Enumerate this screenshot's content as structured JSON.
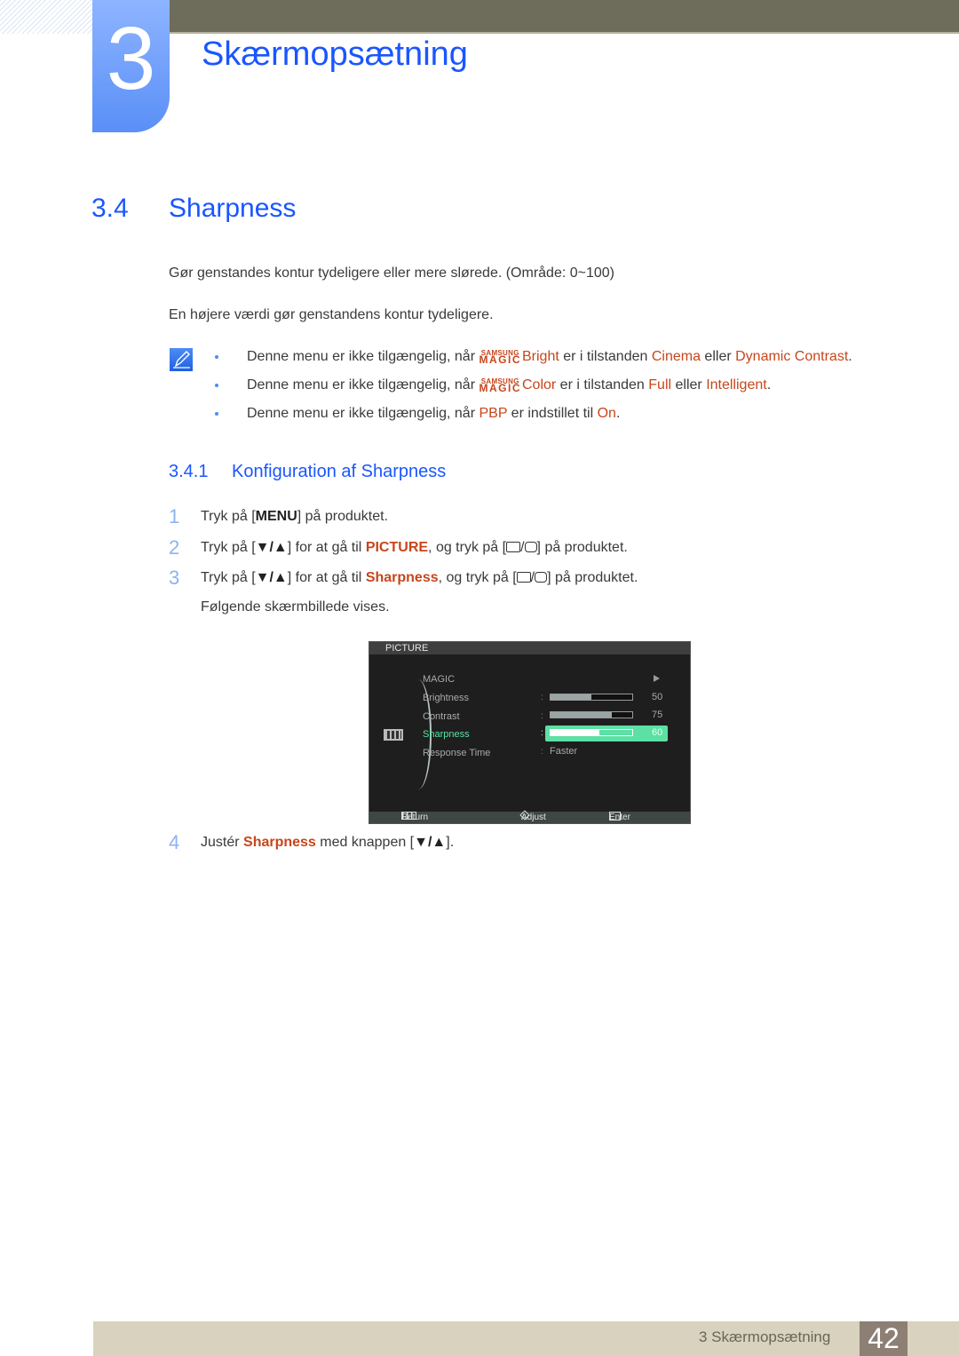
{
  "header": {
    "chapter_number": "3",
    "chapter_title": "Skærmopsætning"
  },
  "section": {
    "number": "3.4",
    "title": "Sharpness",
    "paragraphs": [
      "Gør genstandes kontur tydeligere eller mere slørede. (Område: 0~100)",
      "En højere værdi gør genstandens kontur tydeligere."
    ]
  },
  "notes": {
    "icon": "note-pencil-icon",
    "magic_top": "SAMSUNG",
    "magic_bottom": "MAGIC",
    "items": [
      {
        "pre": "Denne menu er ikke tilgængelig, når ",
        "magic_word": "Bright",
        "mid": " er i tilstanden ",
        "h1": "Cinema",
        "conj": " eller ",
        "h2": "Dynamic Contrast",
        "end": "."
      },
      {
        "pre": "Denne menu er ikke tilgængelig, når ",
        "magic_word": "Color",
        "mid": " er i tilstanden ",
        "h1": "Full",
        "conj": " eller ",
        "h2": "Intelligent",
        "end": "."
      },
      {
        "pre": "Denne menu er ikke tilgængelig, når ",
        "h0": "PBP",
        "mid": " er indstillet til ",
        "h1": "On",
        "end": "."
      }
    ]
  },
  "subsection": {
    "number": "3.4.1",
    "title": "Konfiguration af Sharpness"
  },
  "steps": [
    {
      "n": "1",
      "a": "Tryk på [",
      "key": "MENU",
      "b": "] på produktet."
    },
    {
      "n": "2",
      "a": "Tryk på [",
      "key": "▼/▲",
      "b": "] for at gå til ",
      "hl": "PICTURE",
      "c": ", og tryk på [",
      "d": "] på produktet."
    },
    {
      "n": "3",
      "a": "Tryk på [",
      "key": "▼/▲",
      "b": "] for at gå til ",
      "hl": "Sharpness",
      "c": ", og tryk på [",
      "d": "] på produktet.",
      "follow": "Følgende skærmbillede vises."
    },
    {
      "n": "4",
      "a": "Justér ",
      "hl": "Sharpness",
      "b": " med knappen [",
      "key": "▼/▲",
      "c": "]."
    }
  ],
  "osd": {
    "title": "PICTURE",
    "items": [
      {
        "label": "MAGIC",
        "type": "submenu"
      },
      {
        "label": "Brightness",
        "value": "50",
        "fraction": 0.5
      },
      {
        "label": "Contrast",
        "value": "75",
        "fraction": 0.75
      },
      {
        "label": "Sharpness",
        "value": "60",
        "fraction": 0.6,
        "active": true
      },
      {
        "label": "Response Time",
        "value": "Faster"
      }
    ],
    "colon": ":",
    "footer": {
      "return": "Return",
      "adjust": "Adjust",
      "enter": "Enter"
    }
  },
  "footer": {
    "text": "3 Skærmopsætning",
    "page": "42"
  }
}
